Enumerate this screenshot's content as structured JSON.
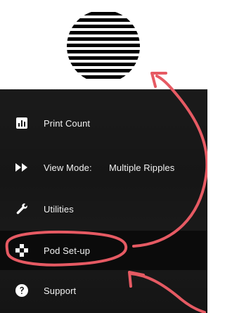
{
  "logo": {
    "icon": "striped-circle-logo-icon",
    "color": "#000000"
  },
  "menu": {
    "background": "#161616",
    "text_color": "#f2f2f2",
    "items": [
      {
        "id": "print-count",
        "label": "Print Count",
        "value": "",
        "icon": "bar-chart-icon"
      },
      {
        "id": "view-mode",
        "label": "View Mode:",
        "value": "Multiple Ripples",
        "icon": "fast-forward-icon"
      },
      {
        "id": "utilities",
        "label": "Utilities",
        "value": "",
        "icon": "wrench-icon"
      },
      {
        "id": "pod-setup",
        "label": "Pod Set-up",
        "value": "",
        "icon": "pod-grid-icon"
      },
      {
        "id": "support",
        "label": "Support",
        "value": "",
        "icon": "help-icon"
      }
    ]
  },
  "annotation": {
    "color": "#e65a63"
  }
}
